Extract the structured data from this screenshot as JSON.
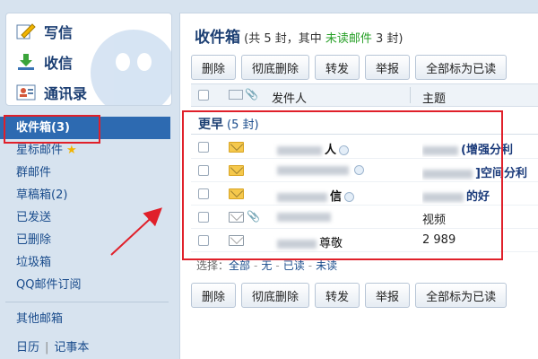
{
  "sidebar": {
    "actions": [
      {
        "label": "写信",
        "icon": "pencil-icon"
      },
      {
        "label": "收信",
        "icon": "download-icon"
      },
      {
        "label": "通讯录",
        "icon": "contacts-icon"
      }
    ],
    "folders": [
      {
        "label": "收件箱(3)",
        "active": true
      },
      {
        "label": "星标邮件",
        "icon": "star-icon",
        "icon_glyph": "★"
      },
      {
        "label": "群邮件"
      },
      {
        "label": "草稿箱(2)"
      },
      {
        "label": "已发送"
      },
      {
        "label": "已删除"
      },
      {
        "label": "垃圾箱"
      },
      {
        "label": "QQ邮件订阅"
      }
    ],
    "other_mailbox": "其他邮箱",
    "calendar": "日历",
    "divider": "|",
    "notes": "记事本"
  },
  "main": {
    "title": "收件箱",
    "subtitle_prefix": " (共 5 封，其中 ",
    "unread_link": "未读邮件",
    "subtitle_suffix": " 3 封)",
    "toolbar": [
      "删除",
      "彻底删除",
      "转发",
      "举报",
      "全部标为已读"
    ],
    "columns": {
      "sender": "发件人",
      "subject": "主题"
    },
    "group": {
      "title": "更早",
      "count": "(5 封)"
    },
    "rows": [
      {
        "sender": "人",
        "subject": "(增强分利",
        "unread": true,
        "attachment": false
      },
      {
        "sender": "",
        "subject": "]空间分利",
        "unread": true,
        "attachment": false
      },
      {
        "sender": "信",
        "subject": "的好",
        "unread": true,
        "attachment": false
      },
      {
        "sender": "",
        "subject": "视频",
        "unread": false,
        "attachment": true
      },
      {
        "sender": "尊敬",
        "subject": "2  989",
        "unread": false,
        "attachment": false
      }
    ],
    "select": {
      "label": "选择：",
      "all": "全部",
      "none": "无",
      "read": "已读",
      "unread": "未读"
    }
  },
  "annotations": {
    "highlight_color": "#e0202a"
  },
  "colors": {
    "accent": "#2d6ab1",
    "link": "#1a4c8c",
    "unread_green": "#28a028"
  }
}
